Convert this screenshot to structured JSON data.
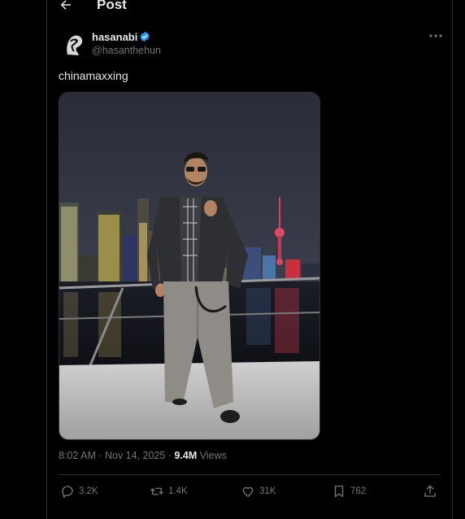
{
  "header": {
    "title": "Post"
  },
  "author": {
    "name": "hasanabi",
    "handle": "@hasanthehun"
  },
  "tweet": {
    "text": "chinamaxxing"
  },
  "meta": {
    "time": "8:02 AM",
    "sep1": " · ",
    "date": "Nov 14, 2025",
    "sep2": " · ",
    "views_count": "9.4M",
    "views_label": " Views"
  },
  "actions": {
    "replies": "3.2K",
    "reposts": "1.4K",
    "likes": "31K",
    "bookmarks": "762"
  },
  "colors": {
    "verified": "#1d9bf0",
    "secondary_text": "#71767b",
    "border": "#2f3336"
  },
  "icons": [
    "back-arrow-icon",
    "verified-badge-icon",
    "more-icon",
    "reply-icon",
    "repost-icon",
    "like-icon",
    "bookmark-icon",
    "share-icon"
  ]
}
